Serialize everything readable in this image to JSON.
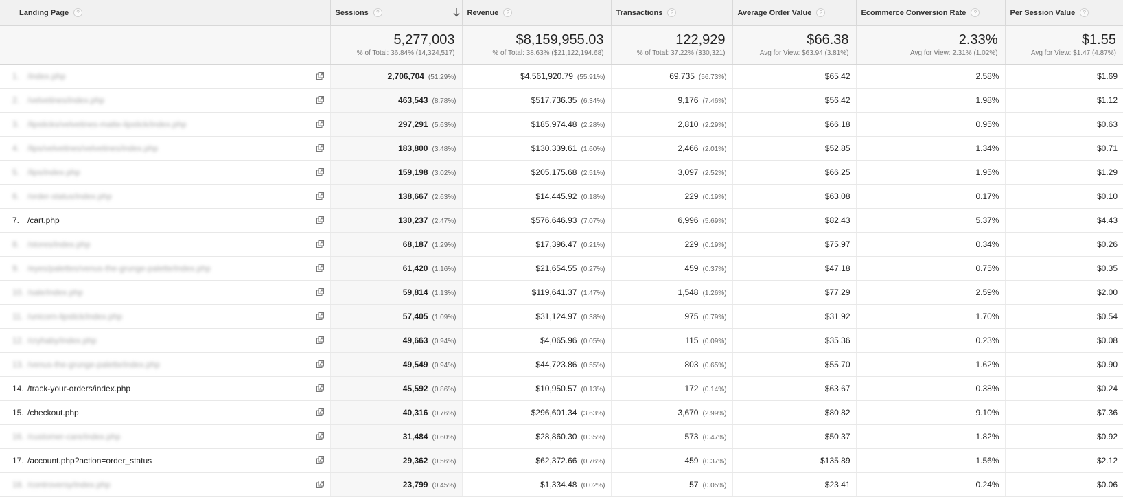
{
  "headers": {
    "landing_page": "Landing Page",
    "sessions": "Sessions",
    "revenue": "Revenue",
    "transactions": "Transactions",
    "aov": "Average Order Value",
    "conversion_rate": "Ecommerce Conversion Rate",
    "per_session_value": "Per Session Value",
    "help_glyph": "?"
  },
  "totals": {
    "sessions": "5,277,003",
    "sessions_sub": "% of Total: 36.84% (14,324,517)",
    "revenue": "$8,159,955.03",
    "revenue_sub": "% of Total: 38.63% ($21,122,194.68)",
    "transactions": "122,929",
    "transactions_sub": "% of Total: 37.22% (330,321)",
    "aov": "$66.38",
    "aov_sub": "Avg for View: $63.94 (3.81%)",
    "conversion_rate": "2.33%",
    "conversion_rate_sub": "Avg for View: 2.31% (1.02%)",
    "per_session_value": "$1.55",
    "per_session_value_sub": "Avg for View: $1.47 (4.87%)"
  },
  "rows": [
    {
      "idx": "1.",
      "page": "/index.php",
      "blur": true,
      "sessions": "2,706,704",
      "sessions_pct": "(51.29%)",
      "revenue": "$4,561,920.79",
      "revenue_pct": "(55.91%)",
      "transactions": "69,735",
      "transactions_pct": "(56.73%)",
      "aov": "$65.42",
      "cr": "2.58%",
      "psv": "$1.69"
    },
    {
      "idx": "2.",
      "page": "/velvetines/index.php",
      "blur": true,
      "sessions": "463,543",
      "sessions_pct": "(8.78%)",
      "revenue": "$517,736.35",
      "revenue_pct": "(6.34%)",
      "transactions": "9,176",
      "transactions_pct": "(7.46%)",
      "aov": "$56.42",
      "cr": "1.98%",
      "psv": "$1.12"
    },
    {
      "idx": "3.",
      "page": "/lipsticks/velvetines-matte-lipstick/index.php",
      "blur": true,
      "sessions": "297,291",
      "sessions_pct": "(5.63%)",
      "revenue": "$185,974.48",
      "revenue_pct": "(2.28%)",
      "transactions": "2,810",
      "transactions_pct": "(2.29%)",
      "aov": "$66.18",
      "cr": "0.95%",
      "psv": "$0.63"
    },
    {
      "idx": "4.",
      "page": "/lips/velvetines/velvetines/index.php",
      "blur": true,
      "sessions": "183,800",
      "sessions_pct": "(3.48%)",
      "revenue": "$130,339.61",
      "revenue_pct": "(1.60%)",
      "transactions": "2,466",
      "transactions_pct": "(2.01%)",
      "aov": "$52.85",
      "cr": "1.34%",
      "psv": "$0.71"
    },
    {
      "idx": "5.",
      "page": "/lips/index.php",
      "blur": true,
      "sessions": "159,198",
      "sessions_pct": "(3.02%)",
      "revenue": "$205,175.68",
      "revenue_pct": "(2.51%)",
      "transactions": "3,097",
      "transactions_pct": "(2.52%)",
      "aov": "$66.25",
      "cr": "1.95%",
      "psv": "$1.29"
    },
    {
      "idx": "6.",
      "page": "/order-status/index.php",
      "blur": true,
      "sessions": "138,667",
      "sessions_pct": "(2.63%)",
      "revenue": "$14,445.92",
      "revenue_pct": "(0.18%)",
      "transactions": "229",
      "transactions_pct": "(0.19%)",
      "aov": "$63.08",
      "cr": "0.17%",
      "psv": "$0.10"
    },
    {
      "idx": "7.",
      "page": "/cart.php",
      "blur": false,
      "sessions": "130,237",
      "sessions_pct": "(2.47%)",
      "revenue": "$576,646.93",
      "revenue_pct": "(7.07%)",
      "transactions": "6,996",
      "transactions_pct": "(5.69%)",
      "aov": "$82.43",
      "cr": "5.37%",
      "psv": "$4.43"
    },
    {
      "idx": "8.",
      "page": "/stores/index.php",
      "blur": true,
      "sessions": "68,187",
      "sessions_pct": "(1.29%)",
      "revenue": "$17,396.47",
      "revenue_pct": "(0.21%)",
      "transactions": "229",
      "transactions_pct": "(0.19%)",
      "aov": "$75.97",
      "cr": "0.34%",
      "psv": "$0.26"
    },
    {
      "idx": "9.",
      "page": "/eyes/palettes/venus-the-grunge-palette/index.php",
      "blur": true,
      "sessions": "61,420",
      "sessions_pct": "(1.16%)",
      "revenue": "$21,654.55",
      "revenue_pct": "(0.27%)",
      "transactions": "459",
      "transactions_pct": "(0.37%)",
      "aov": "$47.18",
      "cr": "0.75%",
      "psv": "$0.35"
    },
    {
      "idx": "10.",
      "page": "/sale/index.php",
      "blur": true,
      "sessions": "59,814",
      "sessions_pct": "(1.13%)",
      "revenue": "$119,641.37",
      "revenue_pct": "(1.47%)",
      "transactions": "1,548",
      "transactions_pct": "(1.26%)",
      "aov": "$77.29",
      "cr": "2.59%",
      "psv": "$2.00"
    },
    {
      "idx": "11.",
      "page": "/unicorn-lipstick/index.php",
      "blur": true,
      "sessions": "57,405",
      "sessions_pct": "(1.09%)",
      "revenue": "$31,124.97",
      "revenue_pct": "(0.38%)",
      "transactions": "975",
      "transactions_pct": "(0.79%)",
      "aov": "$31.92",
      "cr": "1.70%",
      "psv": "$0.54"
    },
    {
      "idx": "12.",
      "page": "/cryhaby/index.php",
      "blur": true,
      "sessions": "49,663",
      "sessions_pct": "(0.94%)",
      "revenue": "$4,065.96",
      "revenue_pct": "(0.05%)",
      "transactions": "115",
      "transactions_pct": "(0.09%)",
      "aov": "$35.36",
      "cr": "0.23%",
      "psv": "$0.08"
    },
    {
      "idx": "13.",
      "page": "/venus-the-grunge-palette/index.php",
      "blur": true,
      "sessions": "49,549",
      "sessions_pct": "(0.94%)",
      "revenue": "$44,723.86",
      "revenue_pct": "(0.55%)",
      "transactions": "803",
      "transactions_pct": "(0.65%)",
      "aov": "$55.70",
      "cr": "1.62%",
      "psv": "$0.90"
    },
    {
      "idx": "14.",
      "page": "/track-your-orders/index.php",
      "blur": false,
      "sessions": "45,592",
      "sessions_pct": "(0.86%)",
      "revenue": "$10,950.57",
      "revenue_pct": "(0.13%)",
      "transactions": "172",
      "transactions_pct": "(0.14%)",
      "aov": "$63.67",
      "cr": "0.38%",
      "psv": "$0.24"
    },
    {
      "idx": "15.",
      "page": "/checkout.php",
      "blur": false,
      "sessions": "40,316",
      "sessions_pct": "(0.76%)",
      "revenue": "$296,601.34",
      "revenue_pct": "(3.63%)",
      "transactions": "3,670",
      "transactions_pct": "(2.99%)",
      "aov": "$80.82",
      "cr": "9.10%",
      "psv": "$7.36"
    },
    {
      "idx": "16.",
      "page": "/customer-care/index.php",
      "blur": true,
      "sessions": "31,484",
      "sessions_pct": "(0.60%)",
      "revenue": "$28,860.30",
      "revenue_pct": "(0.35%)",
      "transactions": "573",
      "transactions_pct": "(0.47%)",
      "aov": "$50.37",
      "cr": "1.82%",
      "psv": "$0.92"
    },
    {
      "idx": "17.",
      "page": "/account.php?action=order_status",
      "blur": false,
      "sessions": "29,362",
      "sessions_pct": "(0.56%)",
      "revenue": "$62,372.66",
      "revenue_pct": "(0.76%)",
      "transactions": "459",
      "transactions_pct": "(0.37%)",
      "aov": "$135.89",
      "cr": "1.56%",
      "psv": "$2.12"
    },
    {
      "idx": "18.",
      "page": "/controversy/index.php",
      "blur": true,
      "sessions": "23,799",
      "sessions_pct": "(0.45%)",
      "revenue": "$1,334.48",
      "revenue_pct": "(0.02%)",
      "transactions": "57",
      "transactions_pct": "(0.05%)",
      "aov": "$23.41",
      "cr": "0.24%",
      "psv": "$0.06"
    }
  ]
}
